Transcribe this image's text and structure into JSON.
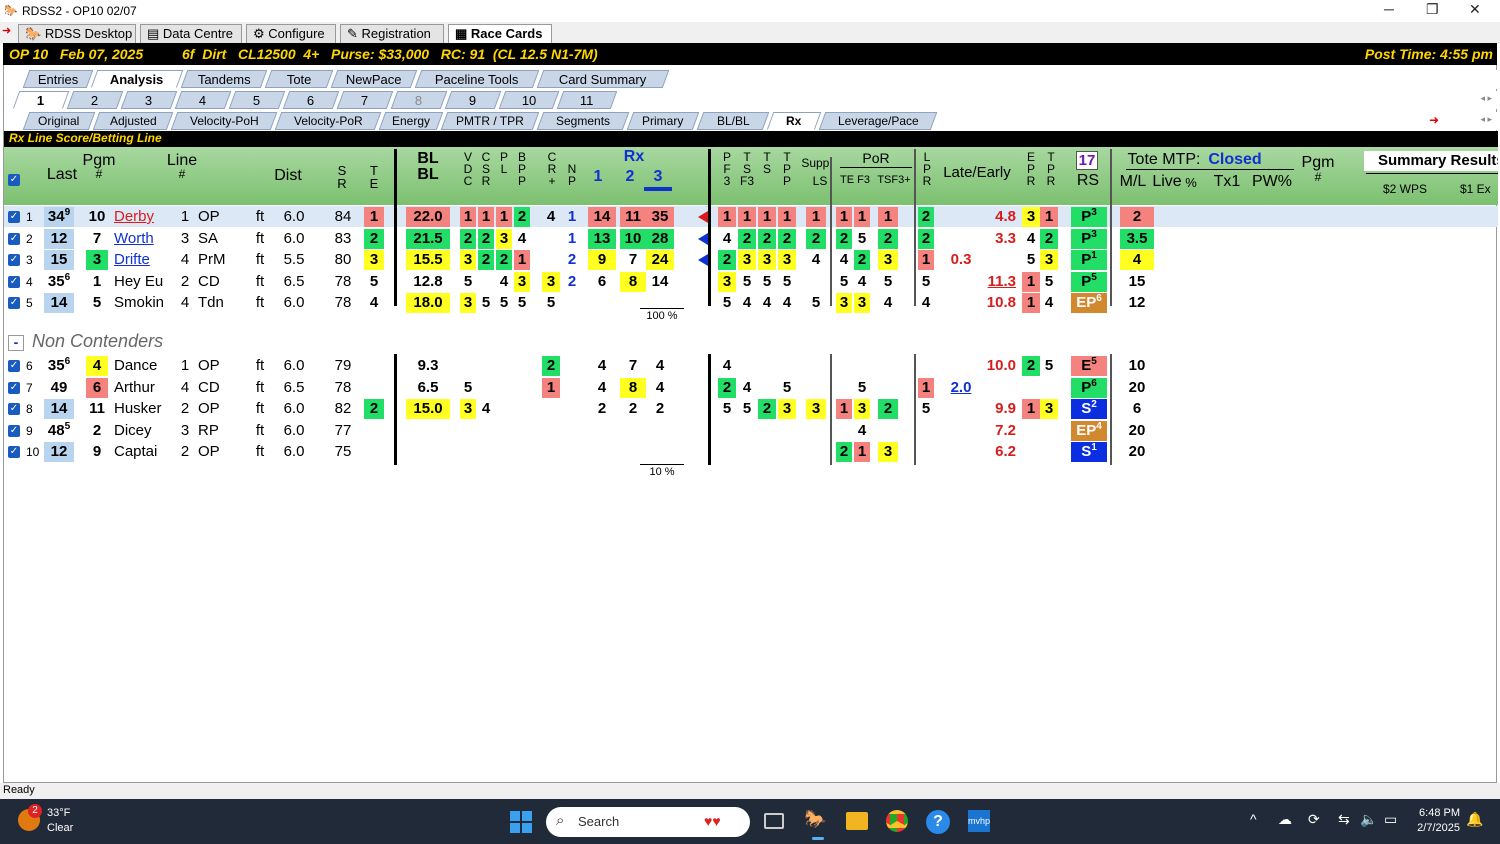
{
  "window": {
    "title": "RDSS2 - OP10  02/07",
    "minimize": "─",
    "maximize": "❐",
    "close": "✕"
  },
  "app_tabs": [
    "RDSS Desktop",
    "Data Centre",
    "Configure",
    "Registration",
    "Race Cards"
  ],
  "race": {
    "info": "OP 10   Feb 07, 2025          6f  Dirt   CL12500  4+   Purse: $33,000   RC: 91  (CL 12.5 N1-7M)",
    "post_time": "Post Time: 4:55 pm"
  },
  "view_tabs": [
    "Entries",
    "Analysis",
    "Tandems",
    "Tote",
    "NewPace",
    "Paceline Tools",
    "Card Summary"
  ],
  "race_tabs": [
    "1",
    "2",
    "3",
    "4",
    "5",
    "6",
    "7",
    "8",
    "9",
    "10",
    "11"
  ],
  "sub_tabs": [
    "Original",
    "Adjusted",
    "Velocity-PoH",
    "Velocity-PoR",
    "Energy",
    "PMTR / TPR",
    "Segments",
    "Primary",
    "BL/BL",
    "Rx",
    "Leverage/Pace"
  ],
  "section_title": "Rx Line Score/Betting Line",
  "headers": {
    "last": "Last",
    "pgm": "Pgm",
    "pgm_hash": "#",
    "line": "Line",
    "line_hash": "#",
    "dist": "Dist",
    "sr": "S\nR",
    "te": "T\nE",
    "blbl": "BL\nBL",
    "vdc": "V\nD\nC",
    "csr": "C\nS\nR",
    "pl": "P\nL",
    "bpp": "B\nP\nP",
    "cr": "C\nR\n+",
    "np": "N\nP",
    "rx": "Rx",
    "rx1": "1",
    "rx2": "2",
    "rx3": "3",
    "pf3": "P\nF\n3",
    "tsf3": "T\nS\nF3",
    "ts": "T\nS",
    "tpp": "T\nP\nP",
    "supp": "Supp.",
    "ls": "LS",
    "por": "PoR",
    "te_f3": "TE F3",
    "tsf3p": "TSF3+",
    "lpr": "L\nP\nR",
    "late_early": "Late/Early",
    "epr": "E\nP\nR",
    "tpr": "T\nP\nR",
    "rs_num": "17",
    "rs": "RS",
    "tote_mtp": "Tote MTP:",
    "tote_status": "Closed",
    "ml": "M/L",
    "live": "Live",
    "pct": "%",
    "tx1": "Tx1",
    "pw": "PW%",
    "pgm2": "Pgm",
    "pgm2_hash": "#",
    "summary": "Summary Results",
    "wps": "$2 WPS",
    "ex": "$1 Ex"
  },
  "contenders": [
    {
      "n": "1",
      "last": "34",
      "last_sup": "9",
      "pgm": "10",
      "name": "Derby",
      "line": "1",
      "trk": "OP",
      "surf": "ft",
      "dist": "6.0",
      "sr": "84",
      "te": "1",
      "blbl": "22.0",
      "vdc": "1",
      "csr": "1",
      "pl": "1",
      "bpp": "2",
      "cr": "4",
      "np": "1",
      "rx1": "14",
      "rx2": "11",
      "rx3": "35",
      "pf3": "1",
      "tsf3": "1",
      "ts": "1",
      "tpp": "1",
      "ls": "1",
      "te2": "1",
      "f3": "1",
      "tsf": "1",
      "lpr": "2",
      "late": "",
      "early": "4.8",
      "epr": "3",
      "tpr": "1",
      "rs": "P",
      "rs_sup": "3",
      "ml": "2"
    },
    {
      "n": "2",
      "last": "12",
      "last_sup": "",
      "pgm": "7",
      "name": "Worth",
      "line": "3",
      "trk": "SA",
      "surf": "ft",
      "dist": "6.0",
      "sr": "83",
      "te": "2",
      "blbl": "21.5",
      "vdc": "2",
      "csr": "2",
      "pl": "3",
      "bpp": "4",
      "cr": "",
      "np": "1",
      "rx1": "13",
      "rx2": "10",
      "rx3": "28",
      "pf3": "4",
      "tsf3": "2",
      "ts": "2",
      "tpp": "2",
      "ls": "2",
      "te2": "2",
      "f3": "5",
      "tsf": "2",
      "lpr": "2",
      "late": "",
      "early": "3.3",
      "epr": "4",
      "tpr": "2",
      "rs": "P",
      "rs_sup": "3",
      "ml": "3.5"
    },
    {
      "n": "3",
      "last": "15",
      "last_sup": "",
      "pgm": "3",
      "name": "Drifte",
      "line": "4",
      "trk": "PrM",
      "surf": "ft",
      "dist": "5.5",
      "sr": "80",
      "te": "3",
      "blbl": "15.5",
      "vdc": "3",
      "csr": "2",
      "pl": "2",
      "bpp": "1",
      "cr": "",
      "np": "2",
      "rx1": "9",
      "rx2": "7",
      "rx3": "24",
      "pf3": "2",
      "tsf3": "3",
      "ts": "3",
      "tpp": "3",
      "ls": "4",
      "te2": "4",
      "f3": "2",
      "tsf": "3",
      "lpr": "1",
      "late": "0.3",
      "early": "",
      "epr": "5",
      "tpr": "3",
      "rs": "P",
      "rs_sup": "1",
      "ml": "4"
    },
    {
      "n": "4",
      "last": "35",
      "last_sup": "6",
      "pgm": "1",
      "name": "Hey Eu",
      "line": "2",
      "trk": "CD",
      "surf": "ft",
      "dist": "6.5",
      "sr": "78",
      "te": "5",
      "blbl": "12.8",
      "vdc": "5",
      "csr": "",
      "pl": "4",
      "bpp": "3",
      "cr": "3",
      "np": "2",
      "rx1": "6",
      "rx2": "8",
      "rx3": "14",
      "pf3": "3",
      "tsf3": "5",
      "ts": "5",
      "tpp": "5",
      "ls": "",
      "te2": "5",
      "f3": "4",
      "tsf": "5",
      "lpr": "5",
      "late": "",
      "early": "11.3",
      "epr": "1",
      "tpr": "5",
      "rs": "P",
      "rs_sup": "5",
      "ml": "15"
    },
    {
      "n": "5",
      "last": "14",
      "last_sup": "",
      "pgm": "5",
      "name": "Smokin",
      "line": "4",
      "trk": "Tdn",
      "surf": "ft",
      "dist": "6.0",
      "sr": "78",
      "te": "4",
      "blbl": "18.0",
      "vdc": "3",
      "csr": "5",
      "pl": "5",
      "bpp": "5",
      "cr": "5",
      "np": "",
      "rx1": "",
      "rx2": "",
      "rx3": "",
      "pf3": "5",
      "tsf3": "4",
      "ts": "4",
      "tpp": "4",
      "ls": "5",
      "te2": "3",
      "f3": "3",
      "tsf": "4",
      "lpr": "4",
      "late": "",
      "early": "10.8",
      "epr": "1",
      "tpr": "4",
      "rs": "EP",
      "rs_sup": "6",
      "ml": "12"
    }
  ],
  "contender_pct": "100 %",
  "non_contenders_label": "Non Contenders",
  "non_contenders": [
    {
      "n": "6",
      "last": "35",
      "last_sup": "6",
      "pgm": "4",
      "name": "Dance",
      "line": "1",
      "trk": "OP",
      "surf": "ft",
      "dist": "6.0",
      "sr": "79",
      "te": "",
      "blbl": "9.3",
      "vdc": "",
      "csr": "",
      "pl": "",
      "bpp": "",
      "cr": "2",
      "np": "",
      "rx1": "4",
      "rx2": "7",
      "rx3": "4",
      "pf3": "4",
      "tsf3": "",
      "ts": "",
      "tpp": "",
      "ls": "",
      "te2": "",
      "f3": "",
      "tsf": "",
      "lpr": "",
      "late": "",
      "early": "10.0",
      "epr": "2",
      "tpr": "5",
      "rs": "E",
      "rs_sup": "5",
      "ml": "10"
    },
    {
      "n": "7",
      "last": "49",
      "last_sup": "",
      "pgm": "6",
      "name": "Arthur",
      "line": "4",
      "trk": "CD",
      "surf": "ft",
      "dist": "6.5",
      "sr": "78",
      "te": "",
      "blbl": "6.5",
      "vdc": "5",
      "csr": "",
      "pl": "",
      "bpp": "",
      "cr": "1",
      "np": "",
      "rx1": "4",
      "rx2": "8",
      "rx3": "4",
      "pf3": "2",
      "tsf3": "4",
      "ts": "",
      "tpp": "5",
      "ls": "",
      "te2": "",
      "f3": "5",
      "tsf": "",
      "lpr": "1",
      "late": "2.0",
      "early": "",
      "epr": "",
      "tpr": "",
      "rs": "P",
      "rs_sup": "6",
      "ml": "20"
    },
    {
      "n": "8",
      "last": "14",
      "last_sup": "",
      "pgm": "11",
      "name": "Husker",
      "line": "2",
      "trk": "OP",
      "surf": "ft",
      "dist": "6.0",
      "sr": "82",
      "te": "2",
      "blbl": "15.0",
      "vdc": "3",
      "csr": "4",
      "pl": "",
      "bpp": "",
      "cr": "",
      "np": "",
      "rx1": "2",
      "rx2": "2",
      "rx3": "2",
      "pf3": "5",
      "tsf3": "5",
      "ts": "2",
      "tpp": "3",
      "ls": "3",
      "te2": "1",
      "f3": "3",
      "tsf": "2",
      "lpr": "5",
      "late": "",
      "early": "9.9",
      "epr": "1",
      "tpr": "3",
      "rs": "S",
      "rs_sup": "2",
      "ml": "6"
    },
    {
      "n": "9",
      "last": "48",
      "last_sup": "5",
      "pgm": "2",
      "name": "Dicey",
      "line": "3",
      "trk": "RP",
      "surf": "ft",
      "dist": "6.0",
      "sr": "77",
      "te": "",
      "blbl": "",
      "vdc": "",
      "csr": "",
      "pl": "",
      "bpp": "",
      "cr": "",
      "np": "",
      "rx1": "",
      "rx2": "",
      "rx3": "",
      "pf3": "",
      "tsf3": "",
      "ts": "",
      "tpp": "",
      "ls": "",
      "te2": "",
      "f3": "4",
      "tsf": "",
      "lpr": "",
      "late": "",
      "early": "7.2",
      "epr": "",
      "tpr": "",
      "rs": "EP",
      "rs_sup": "4",
      "ml": "20"
    },
    {
      "n": "10",
      "last": "12",
      "last_sup": "",
      "pgm": "9",
      "name": "Captai",
      "line": "2",
      "trk": "OP",
      "surf": "ft",
      "dist": "6.0",
      "sr": "75",
      "te": "",
      "blbl": "",
      "vdc": "",
      "csr": "",
      "pl": "",
      "bpp": "",
      "cr": "",
      "np": "",
      "rx1": "",
      "rx2": "",
      "rx3": "",
      "pf3": "",
      "tsf3": "",
      "ts": "",
      "tpp": "",
      "ls": "",
      "te2": "2",
      "f3": "1",
      "tsf": "3",
      "lpr": "",
      "late": "",
      "early": "6.2",
      "epr": "",
      "tpr": "",
      "rs": "S",
      "rs_sup": "1",
      "ml": "20"
    }
  ],
  "non_contender_pct": "10 %",
  "status": "Ready",
  "taskbar": {
    "weather_temp": "33°F",
    "weather_desc": "Clear",
    "weather_badge": "2",
    "search_placeholder": "Search",
    "time": "6:48 PM",
    "date": "2/7/2025"
  }
}
